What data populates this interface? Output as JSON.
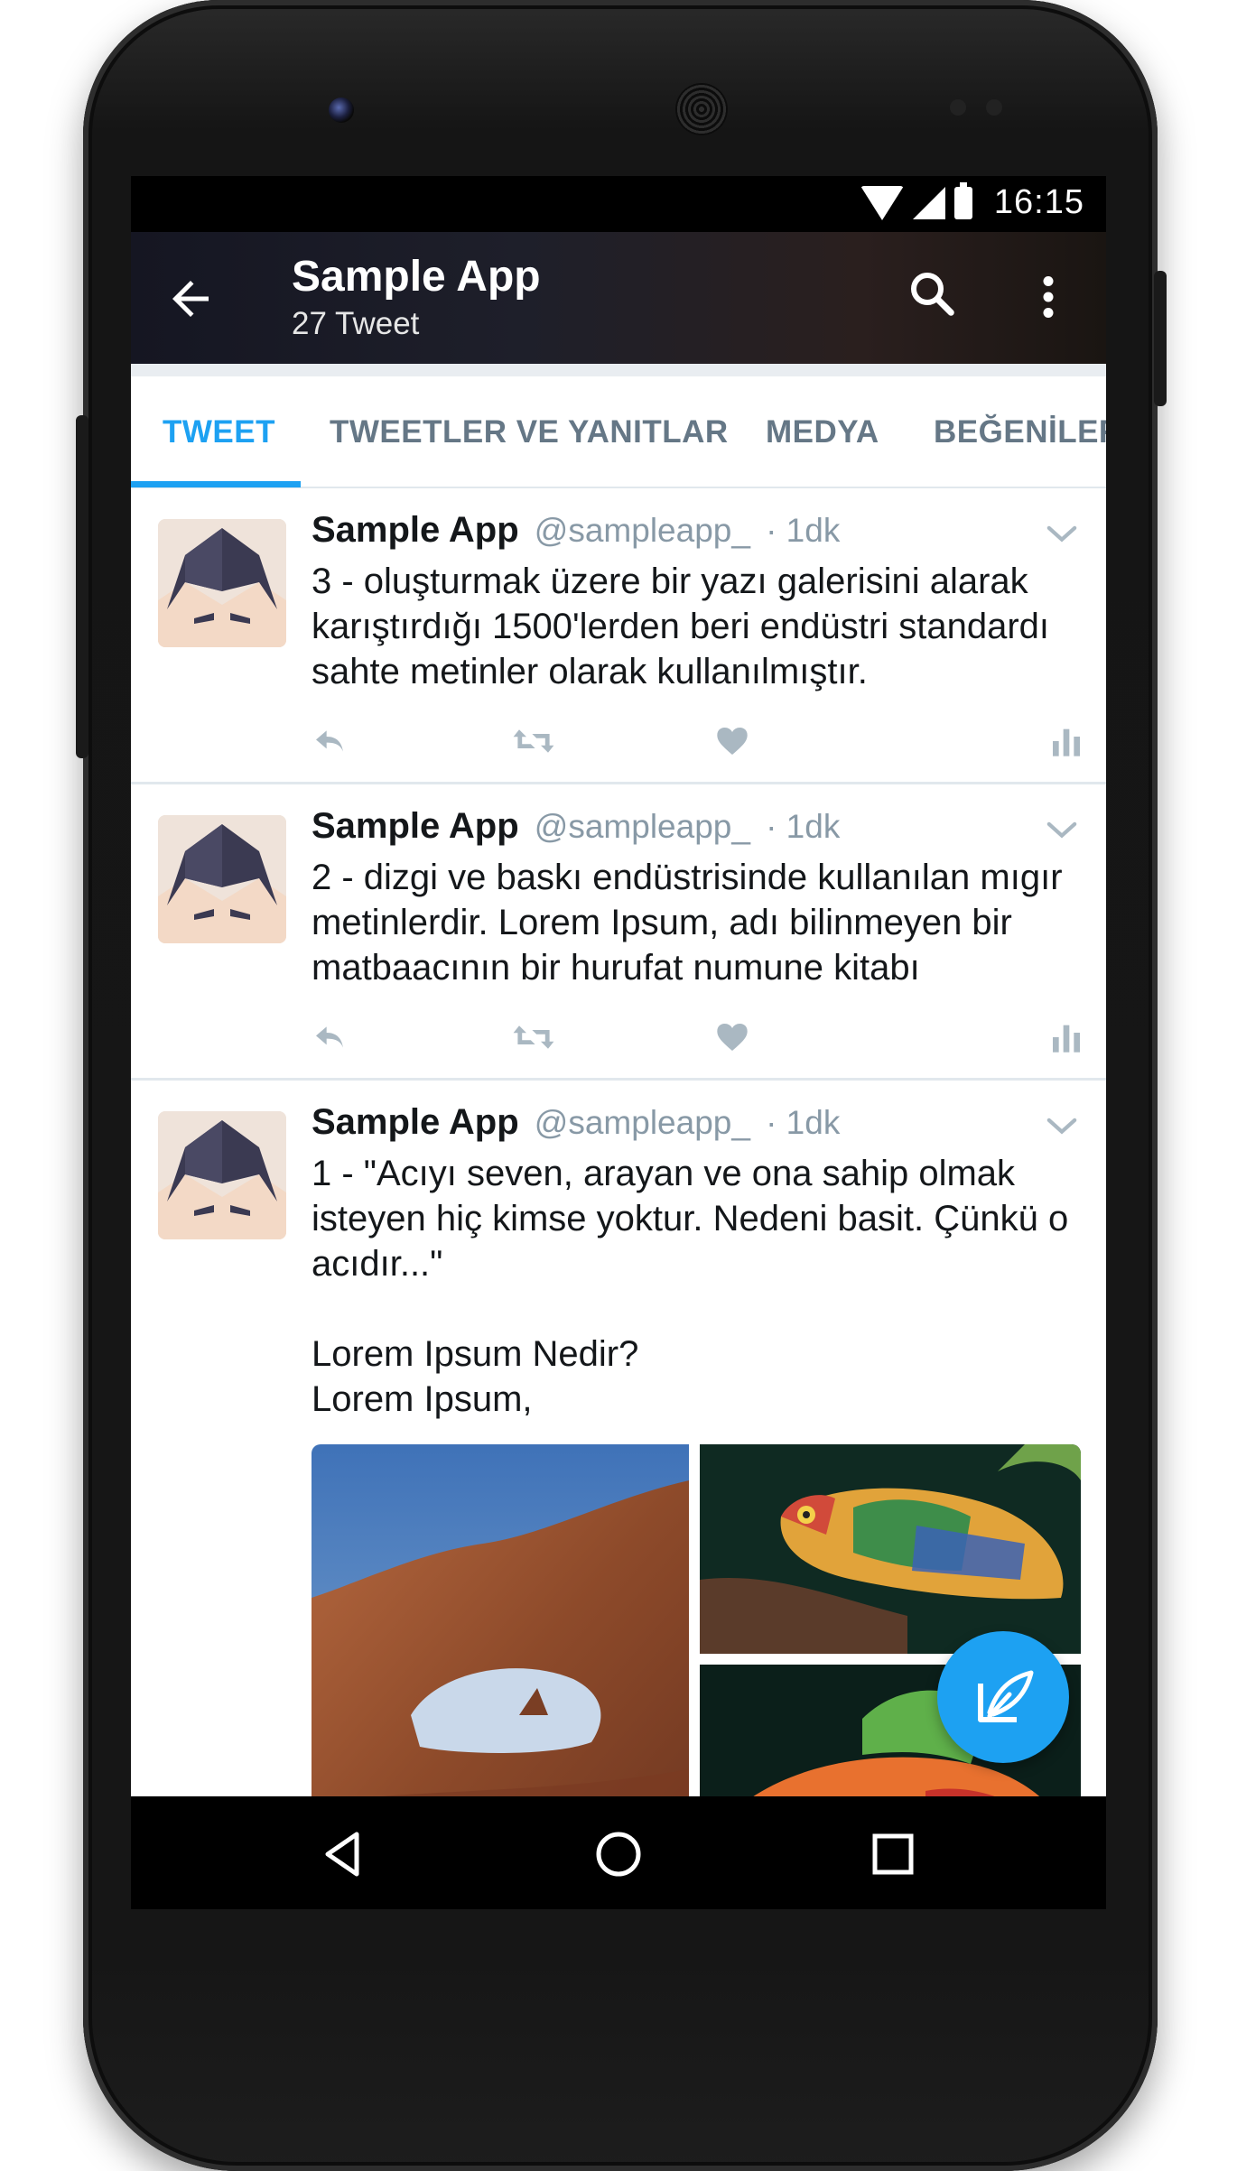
{
  "status_bar": {
    "time": "16:15"
  },
  "app_bar": {
    "title": "Sample App",
    "subtitle": "27 Tweet"
  },
  "tabs": [
    {
      "label": "TWEET",
      "active": true
    },
    {
      "label": "TWEETLER VE YANITLAR",
      "active": false
    },
    {
      "label": "MEDYA",
      "active": false
    },
    {
      "label": "BEĞENİLER",
      "active": false
    }
  ],
  "tweets": [
    {
      "name": "Sample App",
      "handle": "@sampleapp_",
      "time": "· 1dk",
      "text": "3 - oluşturmak üzere bir yazı galerisini alarak karıştırdığı 1500'lerden beri endüstri standardı sahte metinler olarak kullanılmıştır."
    },
    {
      "name": "Sample App",
      "handle": "@sampleapp_",
      "time": "· 1dk",
      "text": "2 - dizgi ve baskı endüstrisinde kullanılan mıgır metinlerdir. Lorem Ipsum, adı bilinmeyen bir matbaacının bir hurufat numune kitabı"
    },
    {
      "name": "Sample App",
      "handle": "@sampleapp_",
      "time": "· 1dk",
      "text": "1 - \"Acıyı seven, arayan ve ona sahip olmak isteyen hiç kimse yoktur. Nedeni basit. Çünkü o acıdır...\"\n\nLorem Ipsum Nedir?\nLorem Ipsum,"
    }
  ],
  "icons": {
    "back": "arrow-left-icon",
    "search": "search-icon",
    "more": "more-vertical-icon",
    "reply": "reply-icon",
    "retweet": "retweet-icon",
    "like": "heart-icon",
    "analytics": "analytics-icon",
    "compose": "compose-tweet-icon",
    "nav_back": "nav-back-icon",
    "nav_home": "nav-home-icon",
    "nav_recents": "nav-recents-icon"
  },
  "colors": {
    "accent": "#1da1f2",
    "tab_inactive": "#657786",
    "secondary_text": "#8899a6",
    "divider": "#e1e8ed",
    "action_icon": "#aab8c2"
  }
}
